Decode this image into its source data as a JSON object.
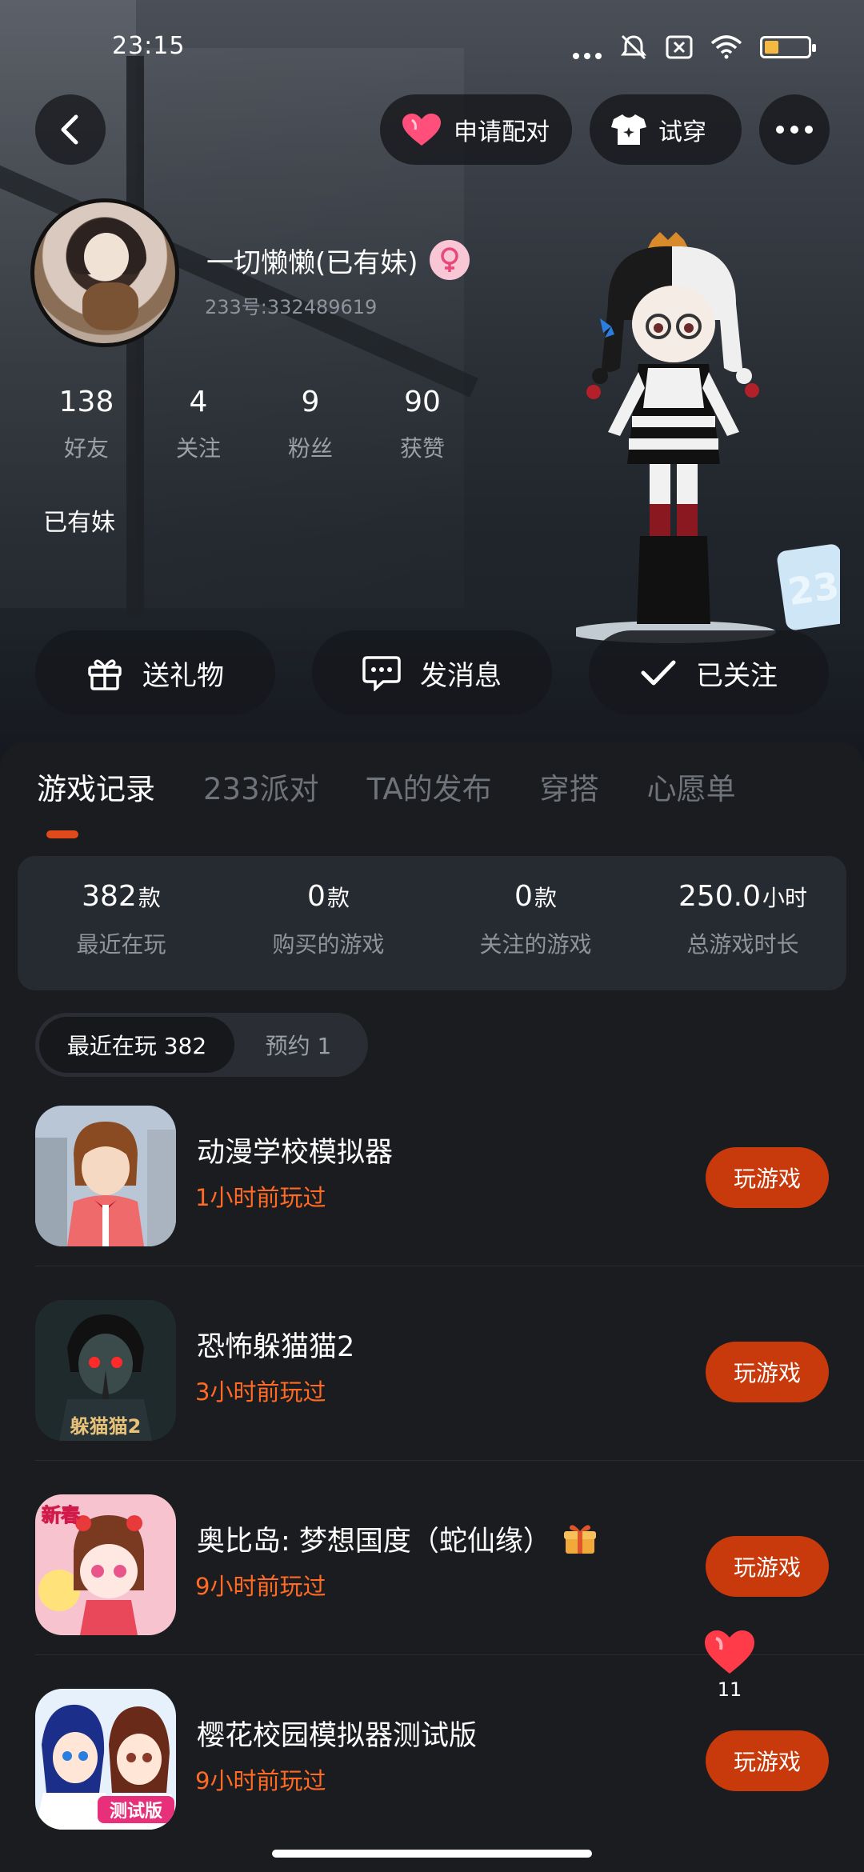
{
  "status_bar": {
    "time": "23:15"
  },
  "top_actions": {
    "match_label": "申请配对",
    "try_on_label": "试穿"
  },
  "profile": {
    "nickname": "一切懒懒(已有妹)",
    "user_id": "233号:332489619",
    "bio": "已有妹",
    "stats": [
      {
        "value": "138",
        "label": "好友"
      },
      {
        "value": "4",
        "label": "关注"
      },
      {
        "value": "9",
        "label": "粉丝"
      },
      {
        "value": "90",
        "label": "获赞"
      }
    ]
  },
  "actions": {
    "gift_label": "送礼物",
    "message_label": "发消息",
    "follow_label": "已关注"
  },
  "tabs": [
    "游戏记录",
    "233派对",
    "TA的发布",
    "穿搭",
    "心愿单"
  ],
  "summary": [
    {
      "value": "382",
      "unit": "款",
      "label": "最近在玩"
    },
    {
      "value": "0",
      "unit": "款",
      "label": "购买的游戏"
    },
    {
      "value": "0",
      "unit": "款",
      "label": "关注的游戏"
    },
    {
      "value": "250.0",
      "unit": "小时",
      "label": "总游戏时长"
    }
  ],
  "segments": {
    "recent": "最近在玩 382",
    "reserve": "预约 1"
  },
  "games": [
    {
      "title": "动漫学校模拟器",
      "time": "1小时前玩过",
      "button": "玩游戏"
    },
    {
      "title": "恐怖躲猫猫2",
      "time": "3小时前玩过",
      "button": "玩游戏",
      "icon_text": "躲猫猫2"
    },
    {
      "title": "奥比岛: 梦想国度（蛇仙缘）",
      "time": "9小时前玩过",
      "button": "玩游戏",
      "icon_text": "新春"
    },
    {
      "title": "樱花校园模拟器测试版",
      "time": "9小时前玩过",
      "button": "玩游戏",
      "icon_text": "测试版"
    }
  ],
  "like_float": {
    "count": "11"
  },
  "colors": {
    "accent": "#c8390c",
    "time_text": "#ff6a24",
    "tab_indicator": "#e0491a"
  }
}
